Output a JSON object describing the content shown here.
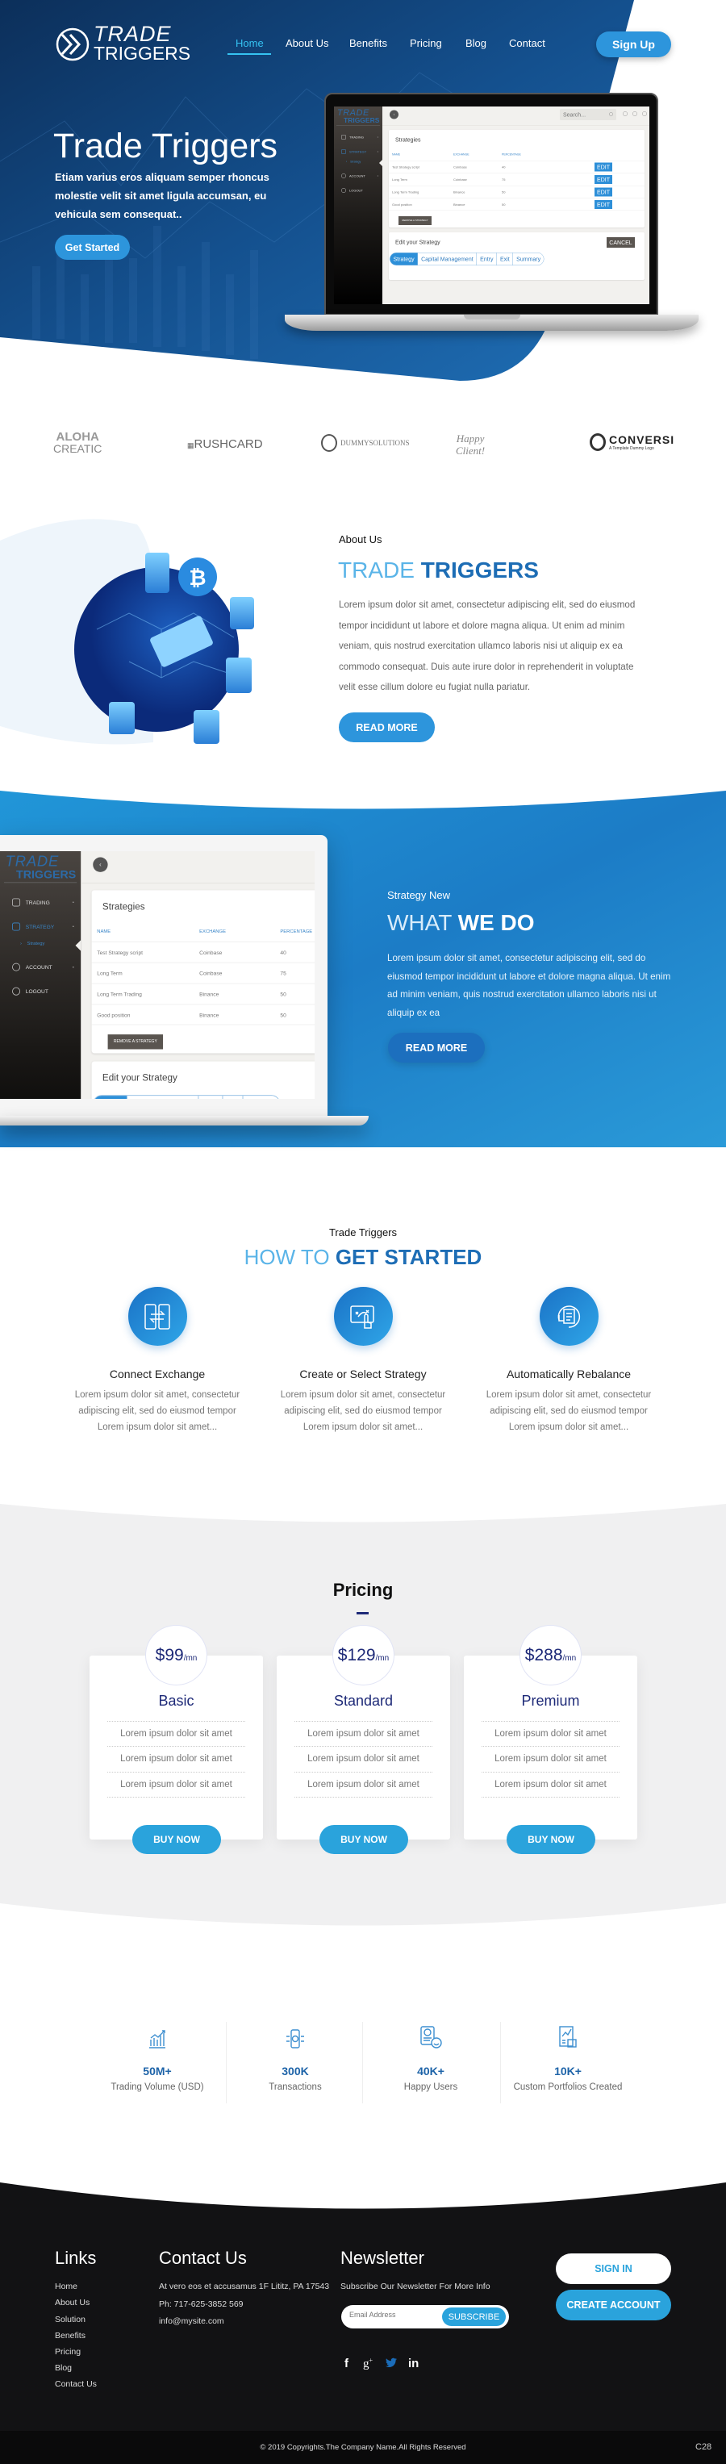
{
  "nav": {
    "logo_top": "TRADE",
    "logo_bottom": "TRIGGERS",
    "items": [
      "Home",
      "About Us",
      "Benefits",
      "Pricing",
      "Blog",
      "Contact"
    ],
    "active": "Home",
    "signup": "Sign Up"
  },
  "hero": {
    "title": "Trade Triggers",
    "subtitle": "Etiam varius eros aliquam semper rhoncus molestie velit sit amet ligula accumsan, eu vehicula sem consequat..",
    "cta": "Get Started"
  },
  "app_mockup": {
    "logo_top": "TRADE",
    "logo_bottom": "TRIGGERS",
    "menu": [
      "TRADING",
      "STRATEGY",
      "Strategy",
      "ACCOUNT",
      "LOGOUT"
    ],
    "search_placeholder": "Search...",
    "strategies_title": "Strategies",
    "columns": [
      "NAME",
      "EXCHANGE",
      "PERCENTAGE"
    ],
    "rows": [
      [
        "Test Strategy script",
        "Coinbase",
        "40"
      ],
      [
        "Long Term",
        "Coinbase",
        "75"
      ],
      [
        "Long Term Trading",
        "Binance",
        "50"
      ],
      [
        "Good position",
        "Binance",
        "50"
      ]
    ],
    "edit_label": "EDIT",
    "remove_label": "REMOVE A STRATEGY",
    "edit_title": "Edit your Strategy",
    "cancel_label": "CANCEL",
    "tabs": [
      "Strategy",
      "Capital Management",
      "Entry",
      "Exit",
      "Summary"
    ]
  },
  "partners": [
    {
      "line1": "ALOHA",
      "line2": "CREATIC"
    },
    {
      "line1": "RUSHCARD",
      "line2": ""
    },
    {
      "line1": "DUMMYSOLUTIONS",
      "line2": ""
    },
    {
      "line1": "Happy",
      "line2": "Client!"
    },
    {
      "line1": "CONVERSI",
      "line2": "A Template Dummy Logo"
    }
  ],
  "about": {
    "eyebrow": "About Us",
    "title_light": "TRADE",
    "title_bold": "TRIGGERS",
    "body": "Lorem ipsum dolor sit amet, consectetur adipiscing elit, sed do eiusmod tempor incididunt ut labore et dolore magna aliqua. Ut enim ad minim veniam, quis nostrud exercitation ullamco laboris nisi ut aliquip ex ea commodo consequat. Duis aute irure dolor in reprehenderit in voluptate velit esse cillum dolore eu fugiat nulla pariatur.",
    "button": "READ MORE"
  },
  "what_we_do": {
    "eyebrow": "Strategy New",
    "title_light": "WHAT",
    "title_bold": "WE DO",
    "body": "Lorem ipsum dolor sit amet, consectetur adipiscing elit, sed do eiusmod tempor incididunt ut labore et dolore magna aliqua. Ut enim ad minim veniam, quis nostrud exercitation ullamco laboris nisi ut aliquip ex ea",
    "button": "READ MORE"
  },
  "how_to": {
    "eyebrow": "Trade Triggers",
    "title_light": "HOW TO",
    "title_bold": "GET STARTED",
    "steps": [
      {
        "title": "Connect Exchange",
        "desc": "Lorem ipsum dolor sit amet, consectetur adipiscing elit, sed do eiusmod tempor Lorem ipsum dolor sit amet..."
      },
      {
        "title": "Create or Select Strategy",
        "desc": "Lorem ipsum dolor sit amet, consectetur adipiscing elit, sed do eiusmod tempor Lorem ipsum dolor sit amet..."
      },
      {
        "title": "Automatically Rebalance",
        "desc": "Lorem ipsum dolor sit amet, consectetur adipiscing elit, sed do eiusmod tempor Lorem ipsum dolor sit amet..."
      }
    ]
  },
  "pricing": {
    "title": "Pricing",
    "per": "/mn",
    "plans": [
      {
        "price": "$99",
        "name": "Basic",
        "features": [
          "Lorem ipsum dolor sit amet",
          "Lorem ipsum dolor sit amet",
          "Lorem ipsum dolor sit amet"
        ],
        "button": "BUY NOW"
      },
      {
        "price": "$129",
        "name": "Standard",
        "features": [
          "Lorem ipsum dolor sit amet",
          "Lorem ipsum dolor sit amet",
          "Lorem ipsum dolor sit amet"
        ],
        "button": "BUY NOW"
      },
      {
        "price": "$288",
        "name": "Premium",
        "features": [
          "Lorem ipsum dolor sit amet",
          "Lorem ipsum dolor sit amet",
          "Lorem ipsum dolor sit amet"
        ],
        "button": "BUY NOW"
      }
    ]
  },
  "stats": [
    {
      "value": "50M+",
      "label": "Trading Volume (USD)",
      "icon": "bar-chart-icon"
    },
    {
      "value": "300K",
      "label": "Transactions",
      "icon": "mobile-coin-icon"
    },
    {
      "value": "40K+",
      "label": "Happy Users",
      "icon": "happy-user-icon"
    },
    {
      "value": "10K+",
      "label": "Custom Portfolios Created",
      "icon": "portfolio-icon"
    }
  ],
  "footer": {
    "links_title": "Links",
    "links": [
      "Home",
      "About Us",
      "Solution",
      "Benefits",
      "Pricing",
      "Blog",
      "Contact Us"
    ],
    "contact_title": "Contact Us",
    "address": "At vero eos et accusamus 1F Lititz, PA 17543",
    "phone": "Ph: 717-625-3852 569",
    "email": "info@mysite.com",
    "newsletter_title": "Newsletter",
    "newsletter_text": "Subscribe Our Newsletter For More Info",
    "email_placeholder": "Email Address",
    "subscribe": "SUBSCRIBE",
    "social": [
      "f",
      "g+",
      "twitter",
      "in"
    ],
    "sign_in": "SIGN IN",
    "create_account": "CREATE ACCOUNT",
    "copyright": "© 2019 Copyrights.The Company Name.All Rights Reserved",
    "corner": "C28"
  },
  "colors": {
    "accent": "#2d9be0",
    "heading_blue": "#1d6db5",
    "navy": "#1e2a78",
    "footer_bg": "#121214"
  }
}
